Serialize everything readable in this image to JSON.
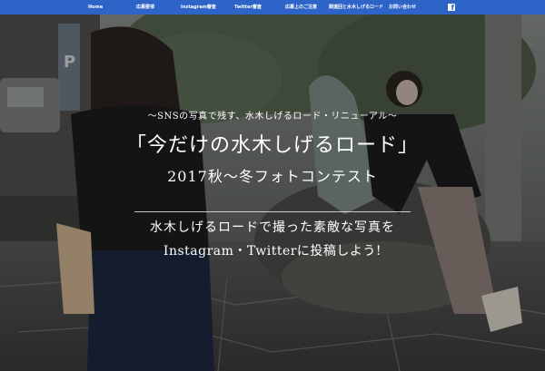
{
  "nav": {
    "items": [
      "Home",
      "応募要項",
      "Instagram審査",
      "Twitter審査",
      "応募上のご注意",
      "関連回と水木しげるロード",
      "お問い合わせ"
    ],
    "facebook_icon": "facebook-icon"
  },
  "hero": {
    "subtitle": "〜SNSの写真で残す、水木しげるロード・リニューアル〜",
    "title": "「今だけの水木しげるロード」",
    "title2": "2017秋〜冬フォトコンテスト",
    "body1": "水木しげるロードで撮った素敵な写真を",
    "body2": "Instagram・Twitterに投稿しよう!"
  },
  "colors": {
    "nav_bg": "#2e63c8",
    "text": "#ffffff"
  }
}
